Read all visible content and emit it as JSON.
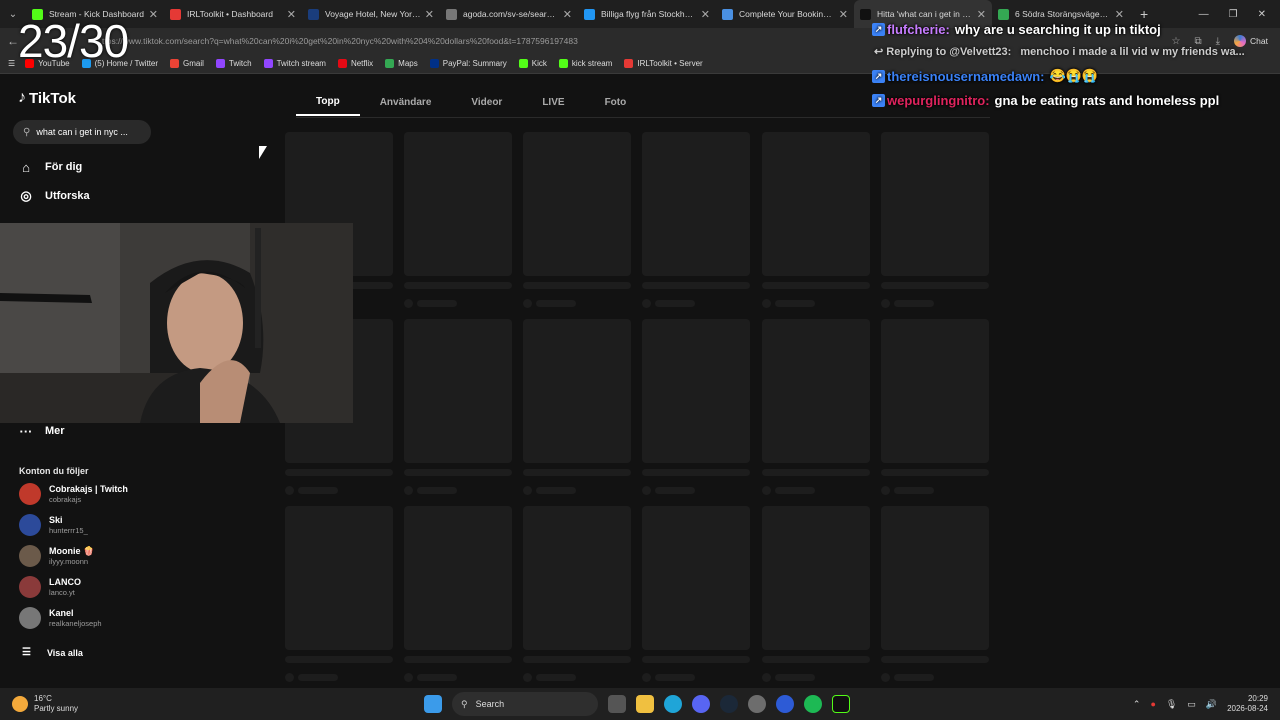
{
  "browser": {
    "tabs": [
      {
        "title": "Stream - Kick Dashboard",
        "color": "#53fc18",
        "active": false
      },
      {
        "title": "IRLToolkit • Dashboard",
        "color": "#e53935",
        "active": false
      },
      {
        "title": "Voyage Hotel, New York Ho",
        "color": "#1a3d7c",
        "active": false
      },
      {
        "title": "agoda.com/sv-se/search?ci",
        "color": "#777777",
        "active": false
      },
      {
        "title": "Billiga flyg från Stockholm ti",
        "color": "#2196f3",
        "active": false
      },
      {
        "title": "Complete Your Booking | Sn",
        "color": "#4a90e2",
        "active": false
      },
      {
        "title": "Hitta 'what can i get in nyc w",
        "color": "#111111",
        "active": true
      },
      {
        "title": "6 Södra Storängsvägen - Go",
        "color": "#34a853",
        "active": false
      }
    ],
    "url": "ttps://www.tiktok.com/search?q=what%20can%20i%20get%20in%20nyc%20with%204%20dollars%20food&t=1787596197483",
    "copilot_label": "Chat",
    "bookmarks": [
      {
        "label": "YouTube",
        "color": "#ff0000"
      },
      {
        "label": "(5) Home / Twitter",
        "color": "#1d9bf0"
      },
      {
        "label": "Gmail",
        "color": "#ea4335"
      },
      {
        "label": "Twitch",
        "color": "#9146ff"
      },
      {
        "label": "Twitch stream",
        "color": "#9146ff"
      },
      {
        "label": "Netflix",
        "color": "#e50914"
      },
      {
        "label": "Maps",
        "color": "#34a853"
      },
      {
        "label": "PayPal: Summary",
        "color": "#003087"
      },
      {
        "label": "Kick",
        "color": "#53fc18"
      },
      {
        "label": "kick stream",
        "color": "#53fc18"
      },
      {
        "label": "IRLToolkit • Server",
        "color": "#e53935"
      }
    ]
  },
  "tiktok": {
    "logo": "TikTok",
    "search_value": "what can i get in nyc ...",
    "nav": {
      "for_you": "För dig",
      "explore": "Utforska",
      "more": "Mer"
    },
    "following_title": "Konton du följer",
    "following": [
      {
        "name": "Cobrakajs | Twitch",
        "handle": "cobrakajs",
        "color": "#c0392b"
      },
      {
        "name": "Ski",
        "handle": "hunterrr15_",
        "color": "#2c4a9a"
      },
      {
        "name": "Moonie 🍿",
        "handle": "ilyyy.moonn",
        "color": "#6b5a4a"
      },
      {
        "name": "LANCO",
        "handle": "lanco.yt",
        "color": "#8a3a3a"
      },
      {
        "name": "Kanel",
        "handle": "realkaneljoseph",
        "color": "#777777"
      }
    ],
    "show_all": "Visa alla",
    "tabs": [
      "Topp",
      "Användare",
      "Videor",
      "LIVE",
      "Foto"
    ]
  },
  "overlay": {
    "counter": "23/30",
    "chat": [
      {
        "user": "flufcherie:",
        "user_color": "#c77dff",
        "message": "why are u searching it up in tiktoj"
      },
      {
        "user": "thereisnousernamedawn:",
        "user_color": "#3b82f6",
        "message": "😂😭😭"
      },
      {
        "user": "wepurglingnitro:",
        "user_color": "#e0245e",
        "message": "gna be eating rats and homeless ppl"
      }
    ],
    "reply": "Replying to @Velvett23:",
    "reply_message": "menchoo i made a lil vid w my friends wa..."
  },
  "taskbar": {
    "weather_temp": "16°C",
    "weather_desc": "Partly sunny",
    "search_label": "Search",
    "time": "20:29",
    "date": "2026-08-24"
  }
}
